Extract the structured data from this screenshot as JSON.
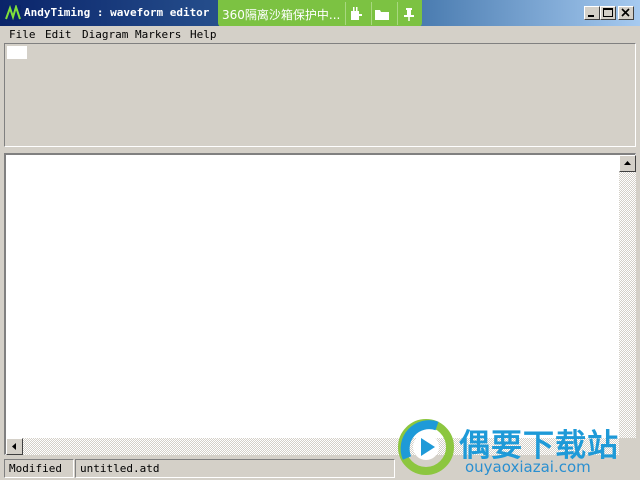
{
  "window": {
    "title": "AndyTiming : waveform editor"
  },
  "sandbox_overlay": {
    "text": "360隔离沙箱保护中...",
    "icons": [
      "plug-icon",
      "folder-icon",
      "pin-icon"
    ],
    "color": "#7cc242"
  },
  "menu": {
    "items": [
      "File",
      "Edit",
      "Diagram",
      "Markers",
      "Help"
    ]
  },
  "statusbar": {
    "state": "Modified",
    "filename": "untitled.atd"
  },
  "watermark": {
    "title": "偶要下载站",
    "url": "ouyaoxiazai.com",
    "color": "#1e9ad8"
  },
  "colors": {
    "titlebar_start": "#0a246a",
    "titlebar_end": "#a6caf0",
    "chrome": "#d4d0c8"
  }
}
